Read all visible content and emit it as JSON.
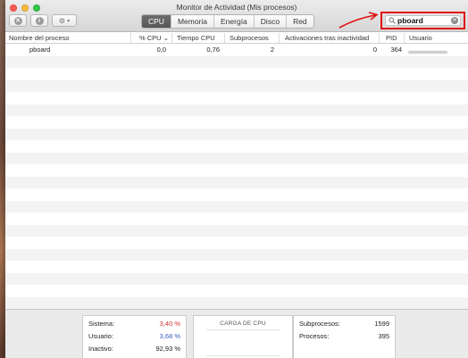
{
  "window": {
    "title": "Monitor de Actividad (Mis procesos)"
  },
  "toolbar": {
    "tabs": [
      {
        "label": "CPU",
        "active": true
      },
      {
        "label": "Memoria"
      },
      {
        "label": "Energía"
      },
      {
        "label": "Disco"
      },
      {
        "label": "Red"
      }
    ]
  },
  "search": {
    "value": "pboard"
  },
  "table": {
    "columns": [
      "Nombre del proceso",
      "% CPU",
      "Tiempo CPU",
      "Subprocesos",
      "Activaciones tras inactividad",
      "PID",
      "Usuario"
    ],
    "sort_indicator": "⌄",
    "rows": [
      {
        "name": "pboard",
        "cpu": "0,0",
        "time": "0,76",
        "threads": "2",
        "wakeups": "0",
        "pid": "364"
      }
    ]
  },
  "footer": {
    "system_label": "Sistema:",
    "system_value": "3,40 %",
    "user_label": "Usuario:",
    "user_value": "3,68 %",
    "idle_label": "Inactivo:",
    "idle_value": "92,93 %",
    "cpu_load_title": "CARGA DE CPU",
    "threads_label": "Subprocesos:",
    "threads_value": "1599",
    "processes_label": "Procesos:",
    "processes_value": "395"
  },
  "colors": {
    "system": "#d0312d",
    "user": "#3a5cc5",
    "highlight": "#e01010"
  }
}
